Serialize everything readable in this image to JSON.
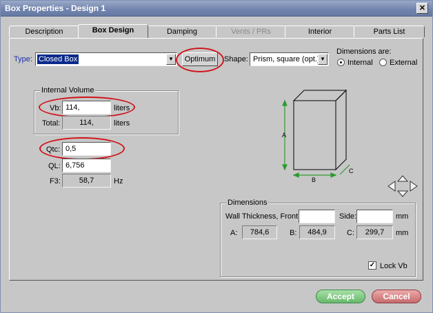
{
  "window": {
    "title": "Box Properties - Design 1",
    "close_label": "✕"
  },
  "tabs": [
    {
      "label": "Description",
      "state": "normal"
    },
    {
      "label": "Box Design",
      "state": "active"
    },
    {
      "label": "Damping",
      "state": "normal"
    },
    {
      "label": "Vents / PRs",
      "state": "disabled"
    },
    {
      "label": "Interior",
      "state": "normal"
    },
    {
      "label": "Parts List",
      "state": "normal"
    }
  ],
  "type": {
    "label": "Type:",
    "value": "Closed Box"
  },
  "optimum_label": "Optimum",
  "shape": {
    "label": "Shape:",
    "value": "Prism, square (opt.)"
  },
  "dimensions_are": {
    "label": "Dimensions are:",
    "options": [
      {
        "label": "Internal",
        "selected": true
      },
      {
        "label": "External",
        "selected": false
      }
    ]
  },
  "internal_volume": {
    "title": "Internal Volume",
    "vb": {
      "label": "Vb:",
      "value": "114,",
      "unit": "liters"
    },
    "total": {
      "label": "Total:",
      "value": "114,",
      "unit": "liters"
    }
  },
  "qtc": {
    "label": "Qtc:",
    "value": "0,5"
  },
  "ql": {
    "label": "QL:",
    "value": "6,756"
  },
  "f3": {
    "label": "F3:",
    "value": "58,7",
    "unit": "Hz"
  },
  "diagram": {
    "a": "A",
    "b": "B",
    "c": "C"
  },
  "dimensions": {
    "title": "Dimensions",
    "wall_label": "Wall Thickness, Front:",
    "wall_front_value": "",
    "side_label": "Side:",
    "side_value": "",
    "unit": "mm",
    "a": {
      "label": "A:",
      "value": "784,6"
    },
    "b": {
      "label": "B:",
      "value": "484,9"
    },
    "c": {
      "label": "C:",
      "value": "299,7"
    },
    "unit2": "mm",
    "lock_vb": {
      "label": "Lock Vb",
      "checked": true
    }
  },
  "buttons": {
    "accept": "Accept",
    "cancel": "Cancel"
  },
  "colors": {
    "highlight": "#d0141b",
    "accept": "#68b86c",
    "cancel": "#c46b6d",
    "diagram_green": "#2e9a2e"
  }
}
